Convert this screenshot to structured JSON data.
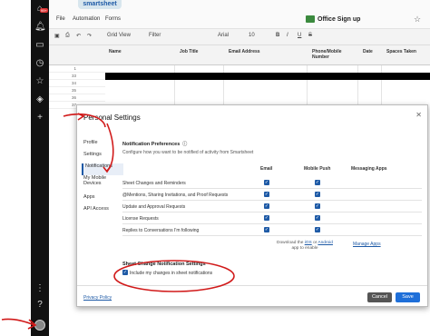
{
  "app": {
    "logo": "smartsheet",
    "menu": [
      "File",
      "Automation",
      "Forms"
    ],
    "sheet_title": "Office Sign up",
    "toolbar": [
      "Grid View",
      "Filter",
      "Arial",
      "10",
      "B",
      "I",
      "U",
      "S"
    ]
  },
  "rail": {
    "badge": "99+"
  },
  "grid": {
    "columns": [
      "Name",
      "Job Title",
      "Email Address",
      "Phone/Mobile Number",
      "Date",
      "Spaces Taken"
    ],
    "row_numbers": [
      "1",
      "33",
      "34",
      "35",
      "36",
      "37"
    ]
  },
  "modal": {
    "title": "Personal Settings",
    "nav": [
      "Profile",
      "Settings",
      "Notifications",
      "My Mobile Devices",
      "Apps",
      "API Access"
    ],
    "prefs_title": "Notification Preferences",
    "prefs_subtitle": "Configure how you want to be notified of activity from Smartsheet",
    "col_email": "Email",
    "col_mobile": "Mobile Push",
    "col_messaging": "Messaging Apps",
    "rows": [
      {
        "label": "Sheet Changes and Reminders"
      },
      {
        "label": "@Mentions, Sharing Invitations, and Proof Requests"
      },
      {
        "label": "Update and Approval Requests"
      },
      {
        "label": "License Requests"
      },
      {
        "label": "Replies to Conversations I'm following"
      }
    ],
    "download_text_1": "Download the",
    "download_ios": "iOS",
    "download_text_2": "or",
    "download_android": "Android",
    "download_text_3": "app to enable",
    "manage_apps": "Manage Apps",
    "sheet_settings_title": "Sheet Change Notification Settings",
    "sheet_settings_option": "Include my changes in sheet notifications",
    "privacy": "Privacy Policy",
    "cancel": "Cancel",
    "save": "Save"
  },
  "colors": {
    "accent": "#1e5aa6",
    "save_button": "#1e6fd9",
    "annotation": "#d11a1a"
  }
}
